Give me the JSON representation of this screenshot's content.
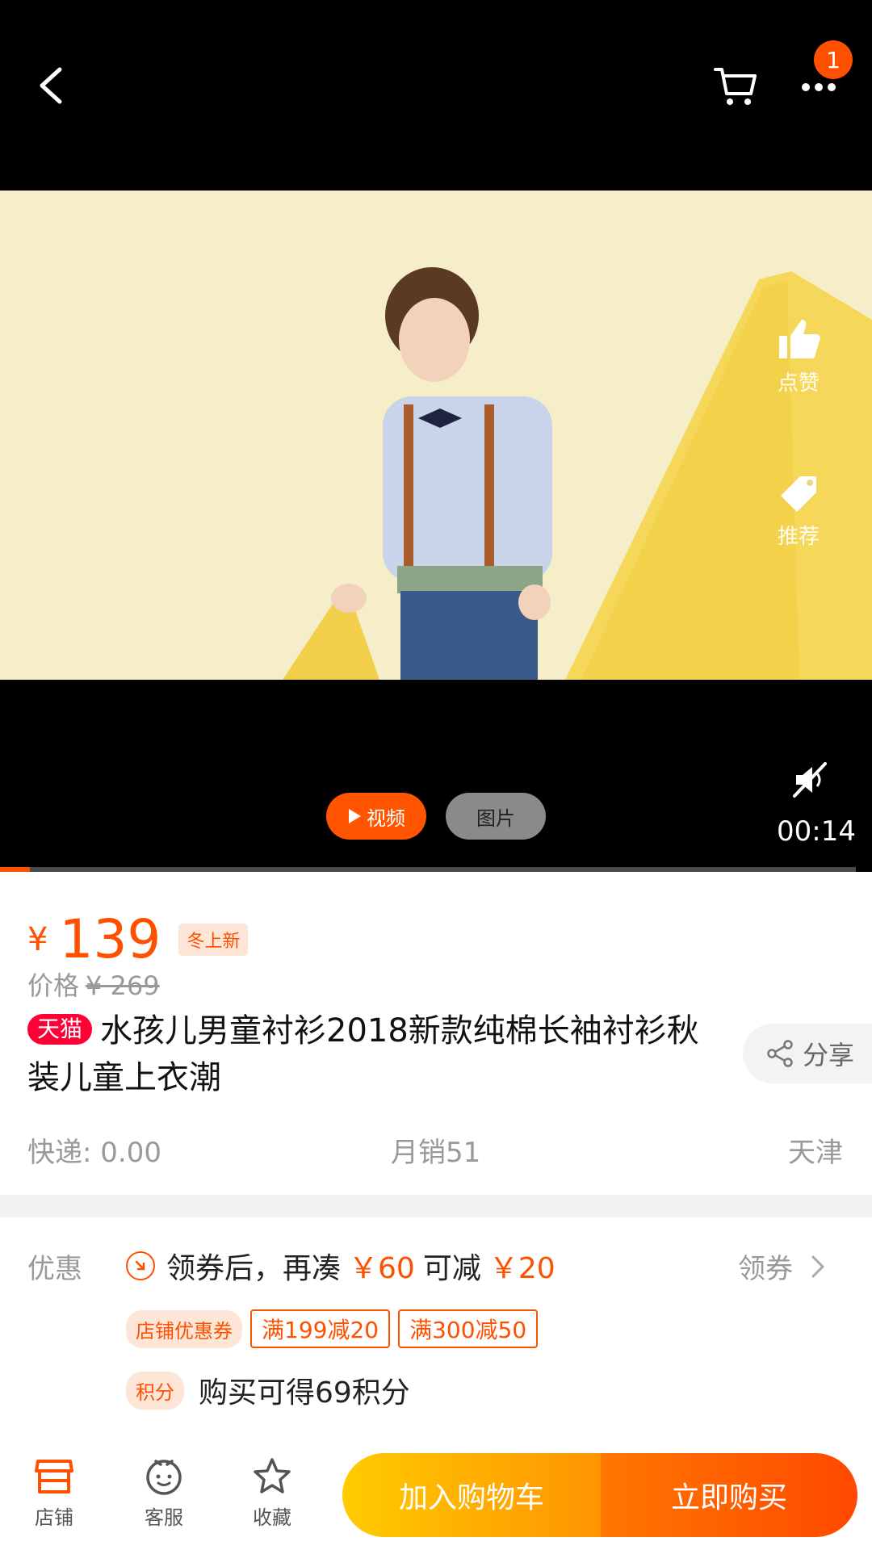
{
  "header": {
    "back_icon": "chevron-left-icon",
    "cart_icon": "cart-icon",
    "more_icon": "more-dots-icon",
    "notification_count": "1"
  },
  "media": {
    "side_actions": [
      {
        "label": "点赞",
        "icon": "thumbs-up-icon"
      },
      {
        "label": "推荐",
        "icon": "tag-icon"
      }
    ],
    "mute_icon": "sound-muted-icon",
    "timer": "00:14",
    "tabs": {
      "video": "视频",
      "photo": "图片"
    },
    "progress_fraction": 0.035
  },
  "product": {
    "currency": "¥",
    "price": "139",
    "promo_tag": "冬上新",
    "original_label": "价格",
    "original_price": "¥ 269",
    "platform_badge": "天猫",
    "title": "水孩儿男童衬衫2018新款纯棉长袖衬衫秋装儿童上衣潮",
    "share_label": "分享",
    "shipping": "快递: 0.00",
    "monthly_sales": "月销51",
    "location": "天津"
  },
  "coupons": {
    "label": "优惠",
    "line": {
      "prefix": "领券后，再凑",
      "amount1": "￥60",
      "middle": "可减",
      "amount2": "￥20"
    },
    "get_coupon": "领券",
    "store_coupon_tag": "店铺优惠券",
    "coupon_items": [
      "满199减20",
      "满300减50"
    ],
    "points_tag": "积分",
    "points_text": "购买可得69积分"
  },
  "bottom_bar": {
    "tabs": [
      {
        "label": "店铺",
        "icon": "shop-icon"
      },
      {
        "label": "客服",
        "icon": "service-icon"
      },
      {
        "label": "收藏",
        "icon": "star-icon"
      }
    ],
    "add_to_cart": "加入购物车",
    "buy_now": "立即购买"
  },
  "colors": {
    "accent": "#ff5000",
    "tmall_red": "#ff0036",
    "cart_gradient_start": "#ffcb00",
    "buy_gradient_end": "#ff4900"
  }
}
